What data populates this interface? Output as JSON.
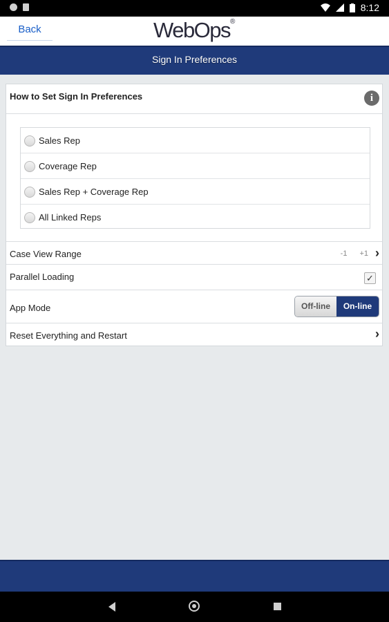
{
  "status_bar": {
    "time": "8:12"
  },
  "header": {
    "back_label": "Back",
    "logo_text": "WebOps",
    "logo_mark": "®",
    "page_title": "Sign In Preferences"
  },
  "preferences": {
    "section_title": "How to Set Sign In Preferences",
    "radio_options": [
      {
        "label": "Sales Rep",
        "selected": false
      },
      {
        "label": "Coverage Rep",
        "selected": false
      },
      {
        "label": "Sales Rep + Coverage Rep",
        "selected": false
      },
      {
        "label": "All Linked Reps",
        "selected": false
      }
    ],
    "case_view_range": {
      "label": "Case View Range",
      "min": "-1",
      "max": "+1"
    },
    "parallel_loading": {
      "label": "Parallel Loading",
      "checked": true
    },
    "app_mode": {
      "label": "App Mode",
      "off_label": "Off-line",
      "on_label": "On-line",
      "selected": "On-line"
    },
    "reset": {
      "label": "Reset Everything and Restart"
    }
  },
  "colors": {
    "brand_navy": "#1f3a7a",
    "link_blue": "#1a5fc8",
    "background": "#e7eaec"
  },
  "icons": {
    "info": "info-icon",
    "chevron": "chevron-right-icon",
    "check": "checkmark-icon"
  }
}
